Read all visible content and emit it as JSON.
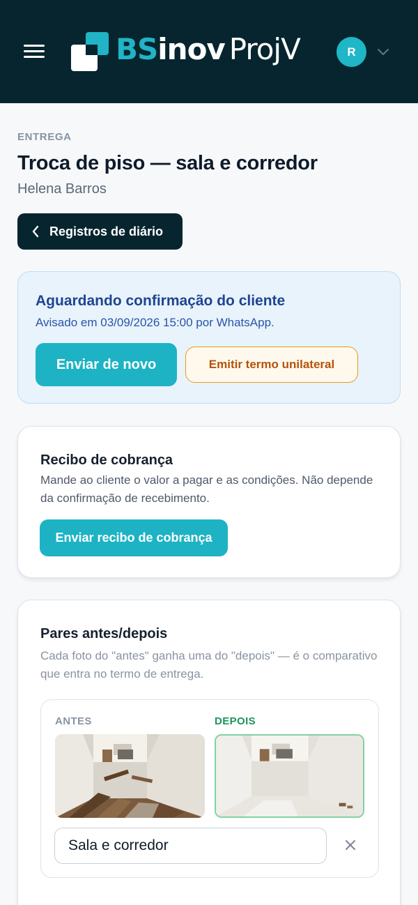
{
  "header": {
    "logo": {
      "part_a": "BS",
      "part_b": "inov",
      "part_c": "ProjV"
    },
    "avatar_initial": "R"
  },
  "page": {
    "eyebrow": "ENTREGA",
    "title": "Troca de piso — sala e corredor",
    "client": "Helena Barros",
    "back_label": "Registros de diário"
  },
  "awaiting": {
    "title": "Aguardando confirmação do cliente",
    "subtitle": "Avisado em 03/09/2026 15:00 por WhatsApp.",
    "resend_label": "Enviar de novo",
    "unilateral_label": "Emitir termo unilateral"
  },
  "receipt": {
    "title": "Recibo de cobrança",
    "description": "Mande ao cliente o valor a pagar e as condições. Não depende da confirmação de recebimento.",
    "button_label": "Enviar recibo de cobrança"
  },
  "pairs": {
    "title": "Pares antes/depois",
    "description": "Cada foto do \"antes\" ganha uma do \"depois\" — é o comparativo que entra no termo de entrega.",
    "items": [
      {
        "before_label": "ANTES",
        "after_label": "DEPOIS",
        "caption": "Sala e corredor"
      }
    ]
  },
  "colors": {
    "header_bg": "#06252f",
    "accent": "#1db3c4",
    "warning": "#e79a1d",
    "success": "#19945e",
    "info_bg": "#e8f3fc"
  }
}
